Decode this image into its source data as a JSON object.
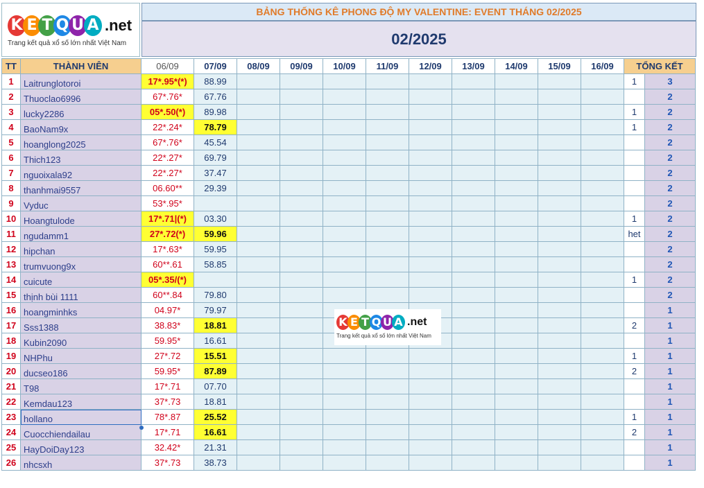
{
  "logo": {
    "letters": [
      "K",
      "E",
      "T",
      "Q",
      "U",
      "A"
    ],
    "letter_colors": [
      "#e53935",
      "#fb8c00",
      "#43a047",
      "#1e88e5",
      "#8e24aa",
      "#00acc1"
    ],
    "suffix": ".net",
    "tagline": "Trang kết quả xổ số lớn nhất Việt Nam"
  },
  "header": {
    "title": "BẢNG THỐNG KÊ PHONG ĐỘ MY VALENTINE: EVENT THÁNG 02/2025",
    "month": "02/2025"
  },
  "columns": {
    "tt": "TT",
    "member": "THÀNH VIÊN",
    "dates": [
      "06/09",
      "07/09",
      "08/09",
      "09/09",
      "10/09",
      "11/09",
      "12/09",
      "13/09",
      "14/09",
      "15/09",
      "16/09"
    ],
    "total": "TỔNG KẾT"
  },
  "rows": [
    {
      "tt": "1",
      "name": "Laitrunglotoroi",
      "c1": "17*.95*(*)",
      "c1_hl": true,
      "c2": "88.99",
      "c2_hl": false,
      "note": "1",
      "total": "3"
    },
    {
      "tt": "2",
      "name": "Thuoclao6996",
      "c1": "67*.76*",
      "c1_hl": false,
      "c2": "67.76",
      "c2_hl": false,
      "note": "",
      "total": "2"
    },
    {
      "tt": "3",
      "name": "lucky2286",
      "c1": "05*.50(*)",
      "c1_hl": true,
      "c2": "89.98",
      "c2_hl": false,
      "note": "1",
      "total": "2"
    },
    {
      "tt": "4",
      "name": "BaoNam9x",
      "c1": "22*.24*",
      "c1_hl": false,
      "c2": "78.79",
      "c2_hl": true,
      "note": "1",
      "total": "2"
    },
    {
      "tt": "5",
      "name": "hoanglong2025",
      "c1": "67*.76*",
      "c1_hl": false,
      "c2": "45.54",
      "c2_hl": false,
      "note": "",
      "total": "2"
    },
    {
      "tt": "6",
      "name": "Thich123",
      "c1": "22*.27*",
      "c1_hl": false,
      "c2": "69.79",
      "c2_hl": false,
      "note": "",
      "total": "2"
    },
    {
      "tt": "7",
      "name": "nguoixala92",
      "c1": "22*.27*",
      "c1_hl": false,
      "c2": "37.47",
      "c2_hl": false,
      "note": "",
      "total": "2"
    },
    {
      "tt": "8",
      "name": "thanhmai9557",
      "c1": "06.60**",
      "c1_hl": false,
      "c2": "29.39",
      "c2_hl": false,
      "note": "",
      "total": "2"
    },
    {
      "tt": "9",
      "name": "Vyduc",
      "c1": "53*.95*",
      "c1_hl": false,
      "c2": "",
      "c2_hl": false,
      "note": "",
      "total": "2"
    },
    {
      "tt": "10",
      "name": "Hoangtulode",
      "c1": "17*.71|(*)",
      "c1_hl": true,
      "c2": "03.30",
      "c2_hl": false,
      "note": "1",
      "total": "2"
    },
    {
      "tt": "11",
      "name": "ngudamm1",
      "c1": "27*.72(*)",
      "c1_hl": true,
      "c2": "59.96",
      "c2_hl": true,
      "note": "het",
      "total": "2"
    },
    {
      "tt": "12",
      "name": "hipchan",
      "c1": "17*.63*",
      "c1_hl": false,
      "c2": "59.95",
      "c2_hl": false,
      "note": "",
      "total": "2"
    },
    {
      "tt": "13",
      "name": "trumvuong9x",
      "c1": "60**.61",
      "c1_hl": false,
      "c2": "58.85",
      "c2_hl": false,
      "note": "",
      "total": "2"
    },
    {
      "tt": "14",
      "name": "cuicute",
      "c1": "05*.35/(*)",
      "c1_hl": true,
      "c2": "",
      "c2_hl": false,
      "note": "1",
      "total": "2"
    },
    {
      "tt": "15",
      "name": "thịnh bùi 1111",
      "c1": "60**.84",
      "c1_hl": false,
      "c2": "79.80",
      "c2_hl": false,
      "note": "",
      "total": "2"
    },
    {
      "tt": "16",
      "name": "hoangminhks",
      "c1": "04.97*",
      "c1_hl": false,
      "c2": "79.97",
      "c2_hl": false,
      "note": "",
      "total": "1"
    },
    {
      "tt": "17",
      "name": "Sss1388",
      "c1": "38.83*",
      "c1_hl": false,
      "c2": "18.81",
      "c2_hl": true,
      "note": "2",
      "total": "1"
    },
    {
      "tt": "18",
      "name": "Kubin2090",
      "c1": "59.95*",
      "c1_hl": false,
      "c2": "16.61",
      "c2_hl": false,
      "note": "",
      "total": "1"
    },
    {
      "tt": "19",
      "name": "NHPhu",
      "c1": "27*.72",
      "c1_hl": false,
      "c2": "15.51",
      "c2_hl": true,
      "note": "1",
      "total": "1"
    },
    {
      "tt": "20",
      "name": "ducseo186",
      "c1": "59.95*",
      "c1_hl": false,
      "c2": "87.89",
      "c2_hl": true,
      "note": "2",
      "total": "1"
    },
    {
      "tt": "21",
      "name": "T98",
      "c1": "17*.71",
      "c1_hl": false,
      "c2": "07.70",
      "c2_hl": false,
      "note": "",
      "total": "1"
    },
    {
      "tt": "22",
      "name": "Kemdau123",
      "c1": "37*.73",
      "c1_hl": false,
      "c2": "18.81",
      "c2_hl": false,
      "note": "",
      "total": "1"
    },
    {
      "tt": "23",
      "name": "hollano",
      "c1": "78*.87",
      "c1_hl": false,
      "c2": "25.52",
      "c2_hl": true,
      "note": "1",
      "total": "1"
    },
    {
      "tt": "24",
      "name": "Cuocchiendailau",
      "c1": "17*.71",
      "c1_hl": false,
      "c2": "16.61",
      "c2_hl": true,
      "note": "2",
      "total": "1"
    },
    {
      "tt": "25",
      "name": "HayDoiDay123",
      "c1": "32.42*",
      "c1_hl": false,
      "c2": "21.31",
      "c2_hl": false,
      "note": "",
      "total": "1"
    },
    {
      "tt": "26",
      "name": "nhcsxh",
      "c1": "37*.73",
      "c1_hl": false,
      "c2": "38.73",
      "c2_hl": false,
      "note": "",
      "total": "1"
    }
  ],
  "colors": {
    "highlight": "#ffff33",
    "name_bg": "#d9d2e6",
    "header_bg": "#f6cf8f",
    "title_orange": "#e07b2a",
    "rank_red": "#d0021b"
  }
}
